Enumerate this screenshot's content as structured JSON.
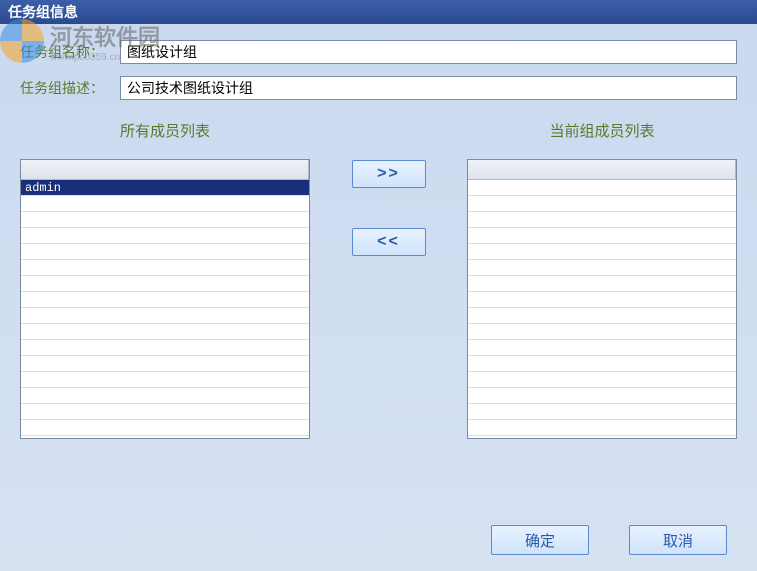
{
  "title": "任务组信息",
  "watermark": {
    "cn": "河东软件园",
    "en": "www.pc0359.cn"
  },
  "form": {
    "name_label": "任务组名称：",
    "name_value": "图纸设计组",
    "desc_label": "任务组描述：",
    "desc_value": "公司技术图纸设计组"
  },
  "lists": {
    "all_members_title": "所有成员列表",
    "current_members_title": "当前组成员列表",
    "all_members": [
      "admin"
    ],
    "current_members": []
  },
  "buttons": {
    "add": "》",
    "remove": "《",
    "ok": "确定",
    "cancel": "取消"
  }
}
